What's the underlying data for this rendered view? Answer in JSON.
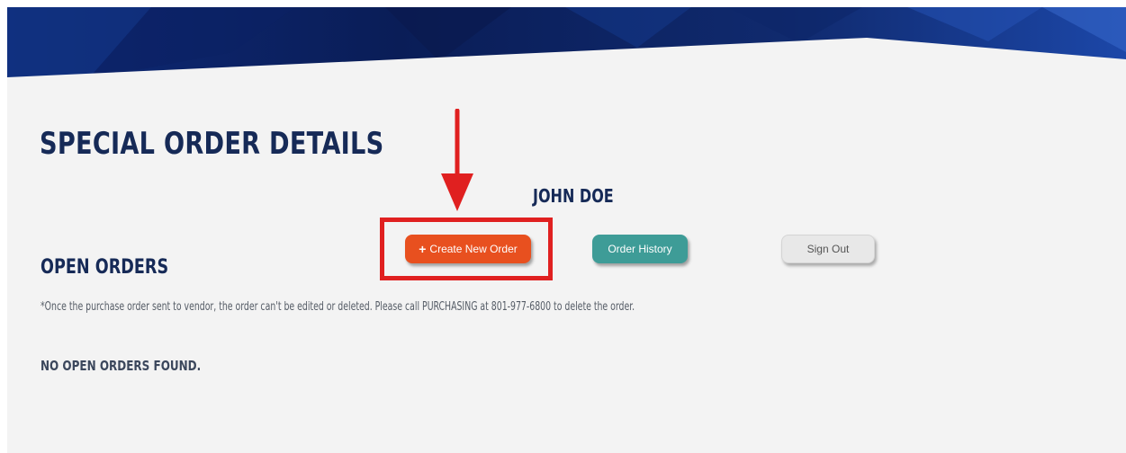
{
  "header": {
    "page_title": "SPECIAL ORDER DETAILS",
    "user_name": "JOHN DOE"
  },
  "actions": {
    "create_new_order": {
      "icon": "plus-icon",
      "icon_glyph": "+",
      "label": "Create New Order"
    },
    "order_history": {
      "label": "Order History"
    },
    "sign_out": {
      "label": "Sign Out"
    }
  },
  "open_orders": {
    "title": "OPEN ORDERS",
    "note": "*Once the purchase order sent to vendor, the order can't be edited or deleted. Please call PURCHASING at 801-977-6800 to delete the order.",
    "empty_message": "NO OPEN ORDERS FOUND."
  },
  "annotations": {
    "arrow_icon": "down-arrow-icon",
    "highlight_color": "#e02020"
  },
  "colors": {
    "banner_dark": "#0b1f55",
    "banner_mid": "#1a3a8a",
    "heading": "#162a57",
    "create_button": "#e8501f",
    "history_button": "#3e9c97",
    "signout_button": "#e8e8e8",
    "page_background": "#f3f3f3"
  }
}
